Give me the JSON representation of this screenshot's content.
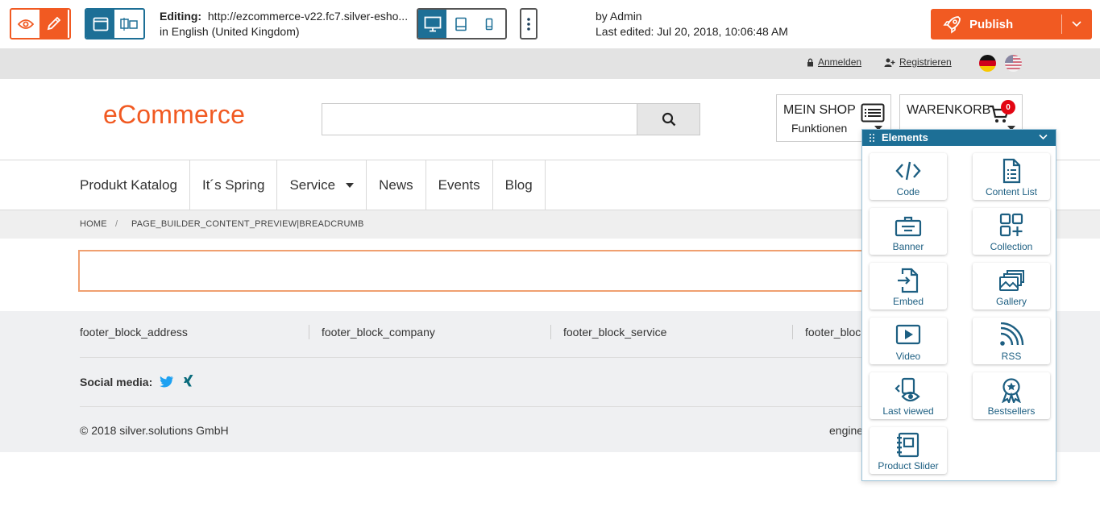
{
  "toolbar": {
    "editing_label": "Editing:",
    "editing_url": "http://ezcommerce-v22.fc7.silver-esho...",
    "language": "in English (United Kingdom)",
    "author": "by Admin",
    "last_edited": "Last edited: Jul 20, 2018, 10:06:48 AM",
    "publish_label": "Publish"
  },
  "utility": {
    "login": "Anmelden",
    "register": "Registrieren"
  },
  "header": {
    "logo": "eCommerce",
    "search_placeholder": "",
    "myshop_title": "MEIN SHOP",
    "myshop_sub": "Funktionen",
    "cart_title": "WARENKORB",
    "cart_count": "0"
  },
  "nav": {
    "items": [
      "Produkt Katalog",
      "It´s Spring",
      "Service",
      "News",
      "Events",
      "Blog"
    ]
  },
  "breadcrumb": {
    "home": "HOME",
    "sep": "/",
    "current": "PAGE_BUILDER_CONTENT_PREVIEW|BREADCRUMB"
  },
  "footer": {
    "cols": [
      "footer_block_address",
      "footer_block_company",
      "footer_block_service",
      "footer_block"
    ],
    "social_label": "Social media:",
    "copyright": "© 2018 silver.solutions GmbH",
    "engine": "engine"
  },
  "panel": {
    "title": "Elements",
    "items": [
      "Code",
      "Content List",
      "Banner",
      "Collection",
      "Embed",
      "Gallery",
      "Video",
      "RSS",
      "Last viewed",
      "Bestsellers",
      "Product Slider"
    ]
  },
  "colors": {
    "accent": "#f15a22",
    "primary_blue": "#1d6f96"
  }
}
